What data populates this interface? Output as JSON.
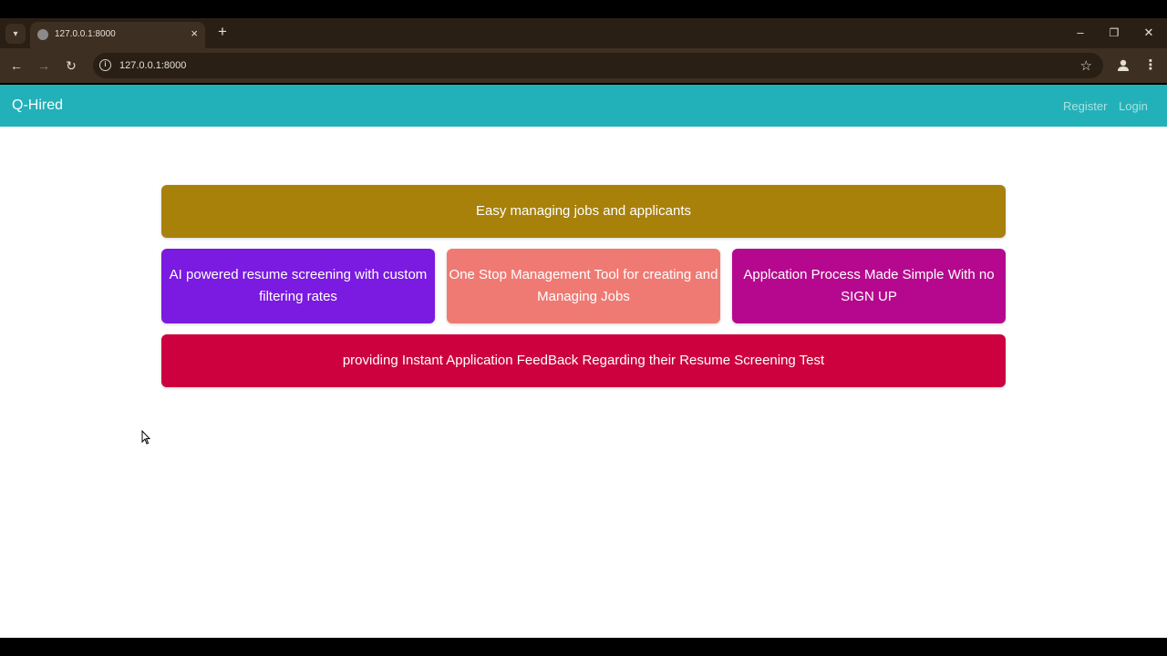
{
  "browser": {
    "tab_title": "127.0.0.1:8000",
    "tab_close": "×",
    "new_tab": "+",
    "url": "127.0.0.1:8000",
    "window_controls": {
      "minimize": "–",
      "restore": "❐",
      "close": "✕"
    }
  },
  "navbar": {
    "brand": "Q-Hired",
    "links": [
      {
        "label": "Register"
      },
      {
        "label": "Login"
      }
    ]
  },
  "features": {
    "top": {
      "text": "Easy managing jobs and applicants",
      "color": "#a7810a"
    },
    "cards": [
      {
        "text": "AI powered resume screening with custom filtering rates",
        "color": "#7b1ae0"
      },
      {
        "text": "One Stop Management Tool for creating and Managing Jobs",
        "color": "#ef7a73"
      },
      {
        "text": "Applcation Process Made Simple With no SIGN UP",
        "color": "#b5088e"
      }
    ],
    "bottom": {
      "text": "providing Instant Application FeedBack Regarding their Resume Screening Test",
      "color": "#cd013d"
    }
  },
  "colors": {
    "navbar": "#22b1b8",
    "chrome_tabstrip": "#2a1f14",
    "chrome_toolbar": "#3d2f22"
  }
}
